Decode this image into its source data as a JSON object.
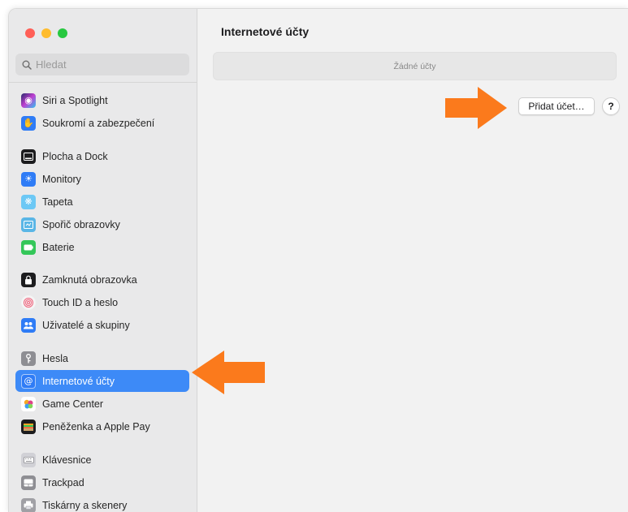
{
  "window": {
    "traffic_lights": {
      "close": "#ff5f57",
      "minimize": "#febc2e",
      "zoom": "#28c840"
    }
  },
  "sidebar": {
    "search": {
      "placeholder": "Hledat",
      "value": ""
    },
    "items": [
      {
        "label": "Siri a Spotlight",
        "icon": "siri-icon",
        "color": "#7b4dd6"
      },
      {
        "label": "Soukromí a zabezpečení",
        "icon": "privacy-hand-icon",
        "color": "#2f7cf6"
      },
      {
        "label": "Plocha a Dock",
        "icon": "dock-icon",
        "color": "#1c1c1e"
      },
      {
        "label": "Monitory",
        "icon": "display-icon",
        "color": "#2f7cf6"
      },
      {
        "label": "Tapeta",
        "icon": "wallpaper-icon",
        "color": "#55bdf0"
      },
      {
        "label": "Spořič obrazovky",
        "icon": "screensaver-icon",
        "color": "#5ab6e6"
      },
      {
        "label": "Baterie",
        "icon": "battery-icon",
        "color": "#34c759"
      },
      {
        "label": "Zamknutá obrazovka",
        "icon": "lock-screen-icon",
        "color": "#1c1c1e"
      },
      {
        "label": "Touch ID a heslo",
        "icon": "fingerprint-icon",
        "color": "#f2f2f2"
      },
      {
        "label": "Uživatelé a skupiny",
        "icon": "users-icon",
        "color": "#2f7cf6"
      },
      {
        "label": "Hesla",
        "icon": "key-icon",
        "color": "#8e8e93"
      },
      {
        "label": "Internetové účty",
        "icon": "at-icon",
        "color": "#2f7cf6",
        "selected": true
      },
      {
        "label": "Game Center",
        "icon": "game-center-icon",
        "color": "#ffffff"
      },
      {
        "label": "Peněženka a Apple Pay",
        "icon": "wallet-icon",
        "color": "#1c1c1e"
      },
      {
        "label": "Klávesnice",
        "icon": "keyboard-icon",
        "color": "#c7c7cc"
      },
      {
        "label": "Trackpad",
        "icon": "trackpad-icon",
        "color": "#8e8e93"
      },
      {
        "label": "Tiskárny a skenery",
        "icon": "printer-icon",
        "color": "#a0a0a5"
      }
    ]
  },
  "main": {
    "title": "Internetové účty",
    "empty_text": "Žádné účty",
    "add_button": "Přidat účet…",
    "help_button": "?"
  },
  "annotation": {
    "arrow_color": "#fb7a1c"
  },
  "colors": {
    "selection": "#3d8af7"
  }
}
